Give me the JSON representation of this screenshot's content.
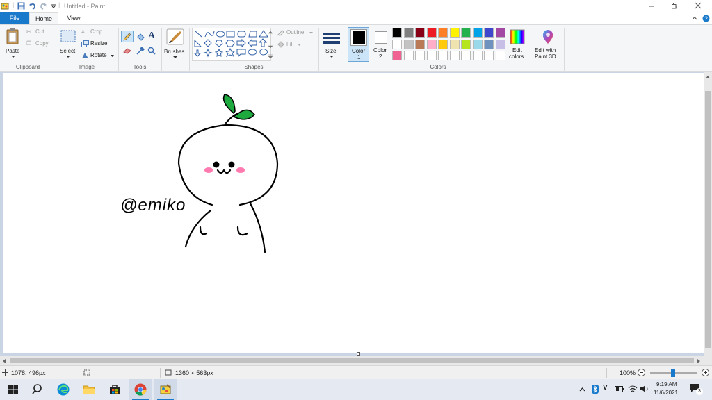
{
  "window": {
    "title": "Untitled - Paint"
  },
  "menu": {
    "file": "File",
    "home": "Home",
    "view": "View"
  },
  "clipboard": {
    "paste": "Paste",
    "cut": "Cut",
    "copy": "Copy",
    "group": "Clipboard"
  },
  "image": {
    "select": "Select",
    "crop": "Crop",
    "resize": "Resize",
    "rotate": "Rotate",
    "group": "Image"
  },
  "tools": {
    "group": "Tools"
  },
  "brushes": {
    "label": "Brushes"
  },
  "shapes": {
    "group": "Shapes",
    "outline": "Outline",
    "fill": "Fill"
  },
  "size": {
    "label": "Size"
  },
  "colors": {
    "group": "Colors",
    "color1": "Color",
    "color1_num": "1",
    "color2": "Color",
    "color2_num": "2",
    "edit_colors_1": "Edit",
    "edit_colors_2": "colors",
    "paint3d_1": "Edit with",
    "paint3d_2": "Paint 3D",
    "row1": [
      "#000000",
      "#7f7f7f",
      "#880015",
      "#ed1c24",
      "#ff7f27",
      "#fff200",
      "#22b14c",
      "#00a2e8",
      "#3f48cc",
      "#a349a4"
    ],
    "row2": [
      "#ffffff",
      "#c3c3c3",
      "#b97a57",
      "#ffaec9",
      "#ffc90e",
      "#efe4b0",
      "#b5e61d",
      "#99d9ea",
      "#7092be",
      "#c8bfe7"
    ],
    "row3": [
      "#f06292",
      "#ffffff",
      "#ffffff",
      "#ffffff",
      "#ffffff",
      "#ffffff",
      "#ffffff",
      "#ffffff",
      "#ffffff",
      "#ffffff"
    ]
  },
  "canvas": {
    "signature": "@emiko"
  },
  "status": {
    "cursor_pos": "1078, 496px",
    "canvas_size": "1360 × 563px",
    "zoom": "100%"
  },
  "taskbar": {
    "time": "9:19 AM",
    "date": "11/6/2021",
    "notifications": "3"
  }
}
